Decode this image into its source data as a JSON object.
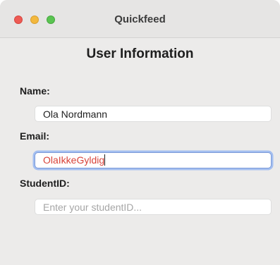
{
  "window": {
    "title": "Quickfeed",
    "colors": {
      "close": "#ee5b54",
      "minimize": "#f3b83d",
      "zoom": "#5ac451",
      "error_text": "#d8433a",
      "focus_ring": "#7c9bd9"
    }
  },
  "form": {
    "heading": "User Information",
    "name": {
      "label": "Name:",
      "value": "Ola Nordmann"
    },
    "email": {
      "label": "Email:",
      "value": "OlaIkkeGyldig"
    },
    "student_id": {
      "label": "StudentID:",
      "placeholder": "Enter your studentID..."
    }
  }
}
